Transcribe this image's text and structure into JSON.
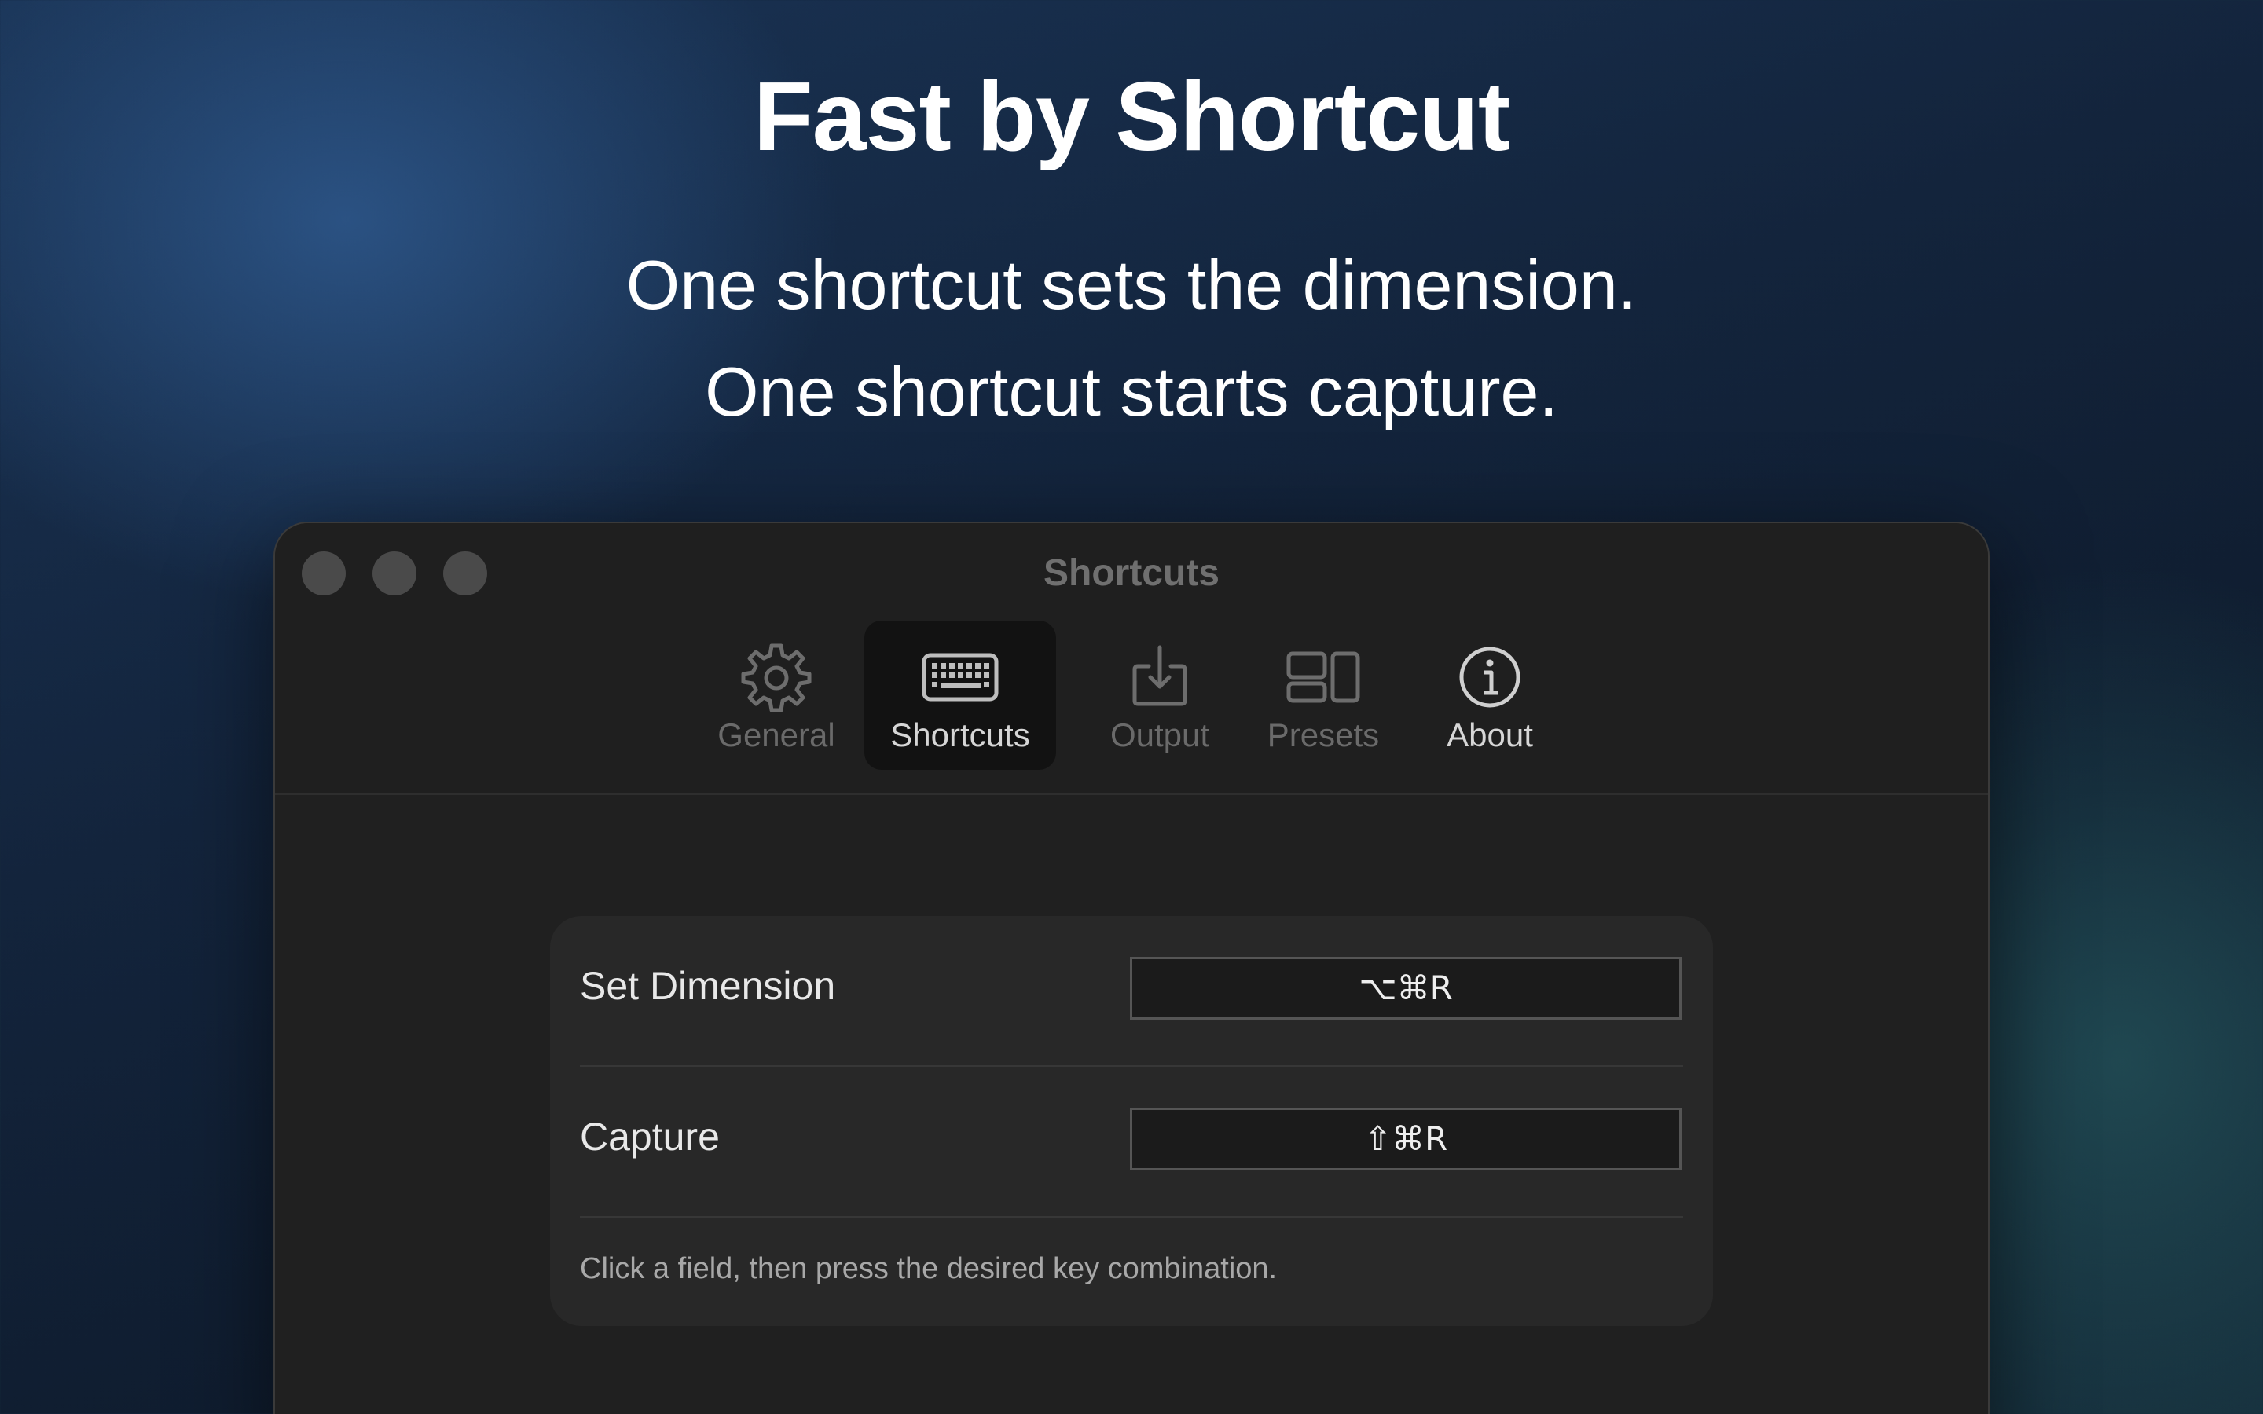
{
  "hero": {
    "title": "Fast by Shortcut",
    "subtitle_line1": "One shortcut sets the dimension.",
    "subtitle_line2": "One shortcut starts capture."
  },
  "window": {
    "title": "Shortcuts",
    "tabs": [
      {
        "label": "General",
        "icon": "gear-icon",
        "state": "inactive"
      },
      {
        "label": "Shortcuts",
        "icon": "keyboard-icon",
        "state": "active"
      },
      {
        "label": "Output",
        "icon": "download-tray-icon",
        "state": "inactive"
      },
      {
        "label": "Presets",
        "icon": "layout-presets-icon",
        "state": "inactive"
      },
      {
        "label": "About",
        "icon": "info-circle-icon",
        "state": "inactive"
      }
    ]
  },
  "shortcuts": {
    "rows": [
      {
        "label": "Set Dimension",
        "keys": "⌥⌘R"
      },
      {
        "label": "Capture",
        "keys": "⇧⌘R"
      }
    ],
    "hint": "Click a field, then press the desired key combination."
  },
  "colors": {
    "accent_text": "#ffffff",
    "window_bg": "#202020",
    "panel_bg": "#282828",
    "active_tab_bg": "#121212"
  }
}
